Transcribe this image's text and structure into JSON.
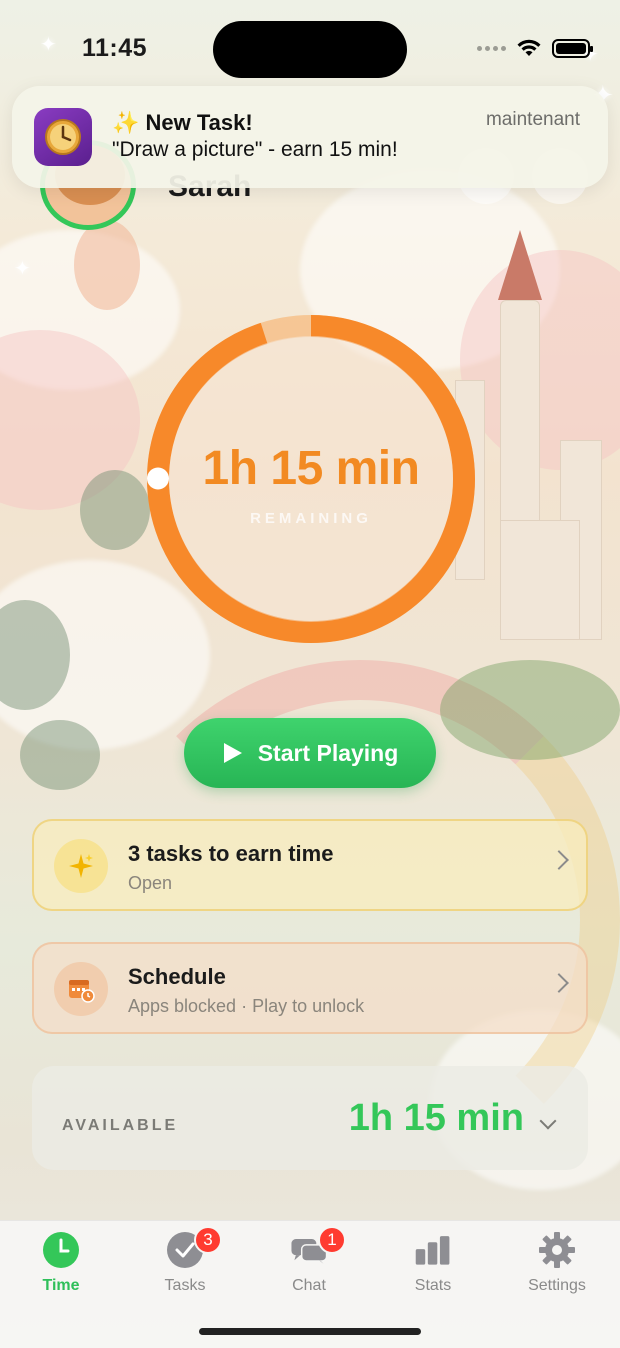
{
  "status_bar": {
    "time": "11:45"
  },
  "notification": {
    "app_icon": "clock-app-icon",
    "title": "✨ New Task!",
    "body": "\"Draw a picture\" - earn 15 min!",
    "time": "maintenant"
  },
  "profile": {
    "name": "Sarah"
  },
  "timer": {
    "value": "1h 15 min",
    "label": "REMAINING",
    "progress_fraction": 0.95,
    "color": "#f28a22"
  },
  "start_button": {
    "label": "Start Playing",
    "icon": "play-icon"
  },
  "cards": {
    "tasks": {
      "title": "3 tasks to earn time",
      "subtitle": "Open",
      "icon": "sparkles-icon"
    },
    "schedule": {
      "title": "Schedule",
      "subtitle": "Apps blocked · Play to unlock",
      "icon": "calendar-clock-icon"
    }
  },
  "available": {
    "label": "AVAILABLE",
    "value": "1h 15 min"
  },
  "tabs": [
    {
      "label": "Time",
      "icon": "clock-icon",
      "active": true
    },
    {
      "label": "Tasks",
      "icon": "checkmark-circle-icon",
      "badge": "3"
    },
    {
      "label": "Chat",
      "icon": "chat-bubbles-icon",
      "badge": "1"
    },
    {
      "label": "Stats",
      "icon": "bar-chart-icon"
    },
    {
      "label": "Settings",
      "icon": "gear-icon"
    }
  ],
  "colors": {
    "accent_green": "#34c759",
    "timer_orange": "#f28a22",
    "badge_red": "#ff3b30"
  }
}
